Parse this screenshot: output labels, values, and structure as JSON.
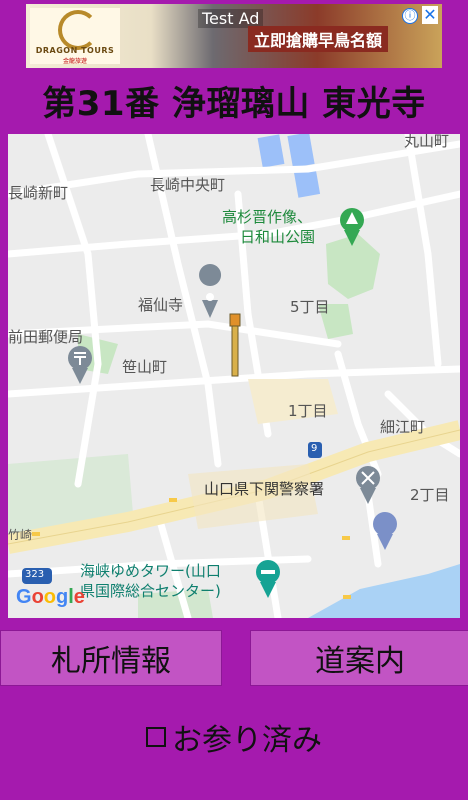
{
  "ad": {
    "label": "Test Ad",
    "headline": "立即搶購早鳥名額",
    "brand": "DRAGON TOURS",
    "brand_sub": "金龍旅遊",
    "info_icon": "info-icon",
    "close_icon": "close-icon",
    "info_glyph": "ⓘ",
    "close_glyph": "✕"
  },
  "title": "第31番 浄瑠璃山 東光寺",
  "map": {
    "labels": {
      "nagasaki_shinmachi": "長崎新町",
      "nagasaki_chuo": "長崎中央町",
      "takasugi_line1": "高杉晋作像、",
      "takasugi_line2": "日和山公園",
      "fukusenji": "福仙寺",
      "gochome": "5丁目",
      "maeda_post": "前田郵便局",
      "sasayama": "笹山町",
      "itchome": "1丁目",
      "hosoe": "細江町",
      "route9": "9",
      "police": "山口県下関警察署",
      "nichome": "2丁目",
      "kaikyo_line1": "海峡ゆめタワー(山口",
      "kaikyo_line2": "県国際総合センター)",
      "route323": "323",
      "top_right": "丸山町",
      "left_edge": "竹崎"
    },
    "google": "Google",
    "colors": {
      "background": "#ececec",
      "road_major": "#f7e9b4",
      "road_minor": "#ffffff",
      "park": "#c8e6c3",
      "water": "#9cc0f9",
      "sea": "#aad2f5"
    }
  },
  "buttons": {
    "info": "札所情報",
    "directions": "道案内"
  },
  "visited": {
    "label": "お参り済み",
    "checked": false
  }
}
